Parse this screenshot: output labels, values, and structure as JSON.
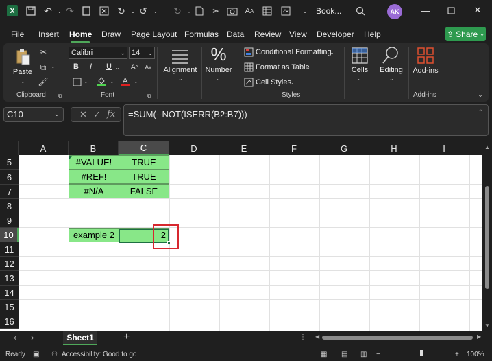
{
  "titlebar": {
    "title": "Book...",
    "avatar_initials": "AK",
    "icons": [
      "excel-logo",
      "save-icon",
      "undo-icon",
      "redo-icon",
      "new-icon",
      "close-x-icon",
      "cut-icon",
      "camera-icon",
      "font-size-icon",
      "table-icon",
      "format-icon",
      "search-icon"
    ]
  },
  "menu": {
    "items": [
      "File",
      "Insert",
      "Home",
      "Draw",
      "Page Layout",
      "Formulas",
      "Data",
      "Review",
      "View",
      "Developer",
      "Help"
    ],
    "active": "Home",
    "share_label": "Share"
  },
  "ribbon": {
    "clipboard": {
      "paste": "Paste",
      "group_label": "Clipboard"
    },
    "font": {
      "font_name": "Calibri",
      "font_size": "14",
      "bold": "B",
      "italic": "I",
      "underline": "U",
      "group_label": "Font"
    },
    "alignment": {
      "label": "Alignment"
    },
    "number": {
      "label": "Number",
      "icon_glyph": "%"
    },
    "styles": {
      "conditional": "Conditional Formatting",
      "format_table": "Format as Table",
      "cell_styles": "Cell Styles",
      "group_label": "Styles"
    },
    "cells": {
      "label": "Cells"
    },
    "editing": {
      "label": "Editing"
    },
    "addins": {
      "label": "Add-ins",
      "group_label": "Add-ins"
    }
  },
  "formula_bar": {
    "name_box": "C10",
    "fx": "fx",
    "formula": "=SUM(--NOT(ISERR(B2:B7)))"
  },
  "grid": {
    "columns": [
      "A",
      "B",
      "C",
      "D",
      "E",
      "F",
      "G",
      "H",
      "I"
    ],
    "selected_column": "C",
    "rows": [
      "5",
      "6",
      "7",
      "8",
      "9",
      "10",
      "11",
      "12",
      "13",
      "14",
      "15",
      "16"
    ],
    "selected_row": "10",
    "cells": {
      "B5": "#VALUE!",
      "C5": "TRUE",
      "B6": "#REF!",
      "C6": "TRUE",
      "B7": "#N/A",
      "C7": "FALSE",
      "B10": "example 2",
      "C10": "2"
    },
    "fill_color": "#88e788",
    "highlight_color": "#d7282f"
  },
  "sheets": {
    "tabs": [
      "Sheet1"
    ],
    "active": "Sheet1",
    "add_label": "+"
  },
  "statusbar": {
    "ready": "Ready",
    "accessibility": "Accessibility: Good to go",
    "zoom": "100%",
    "zoom_minus": "−",
    "zoom_plus": "+"
  }
}
